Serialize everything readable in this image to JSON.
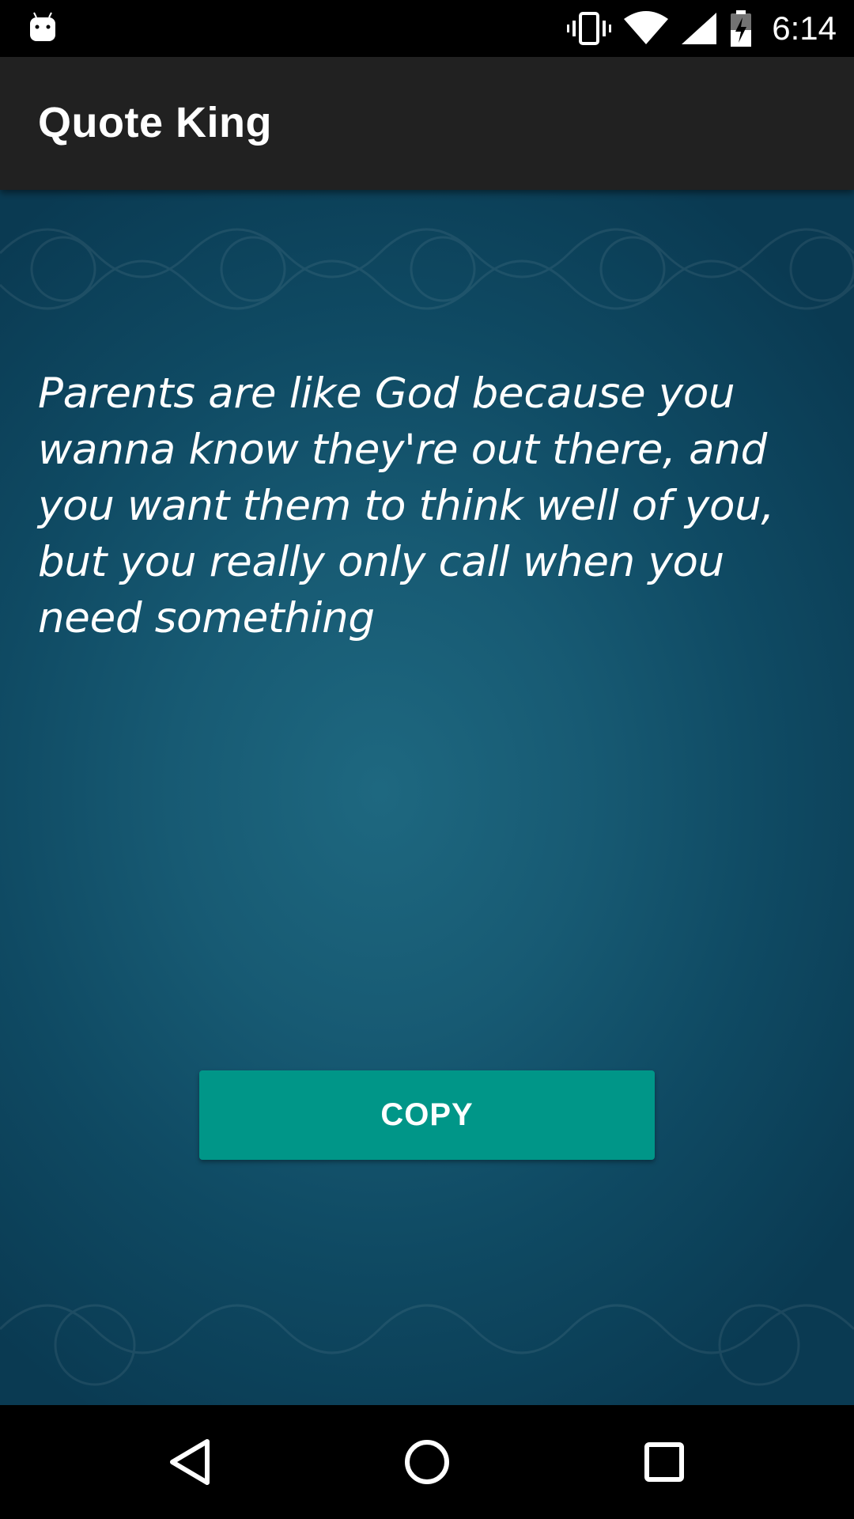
{
  "status_bar": {
    "time": "6:14",
    "icons": [
      "android-notification-icon",
      "vibrate-icon",
      "wifi-icon",
      "cell-signal-icon",
      "battery-charging-icon"
    ]
  },
  "app_bar": {
    "title": "Quote King"
  },
  "quote": {
    "text": "Parents are like God because you wanna know they're out there, and you want them to think well of you, but you really only call when you need something"
  },
  "actions": {
    "copy_label": "COPY"
  },
  "nav_bar": {
    "icons": [
      "back-icon",
      "home-icon",
      "recents-icon"
    ]
  },
  "colors": {
    "app_bar": "#212121",
    "background_center": "#1e6880",
    "background_edge": "#0a3a52",
    "button": "#009688",
    "text": "#ffffff"
  }
}
